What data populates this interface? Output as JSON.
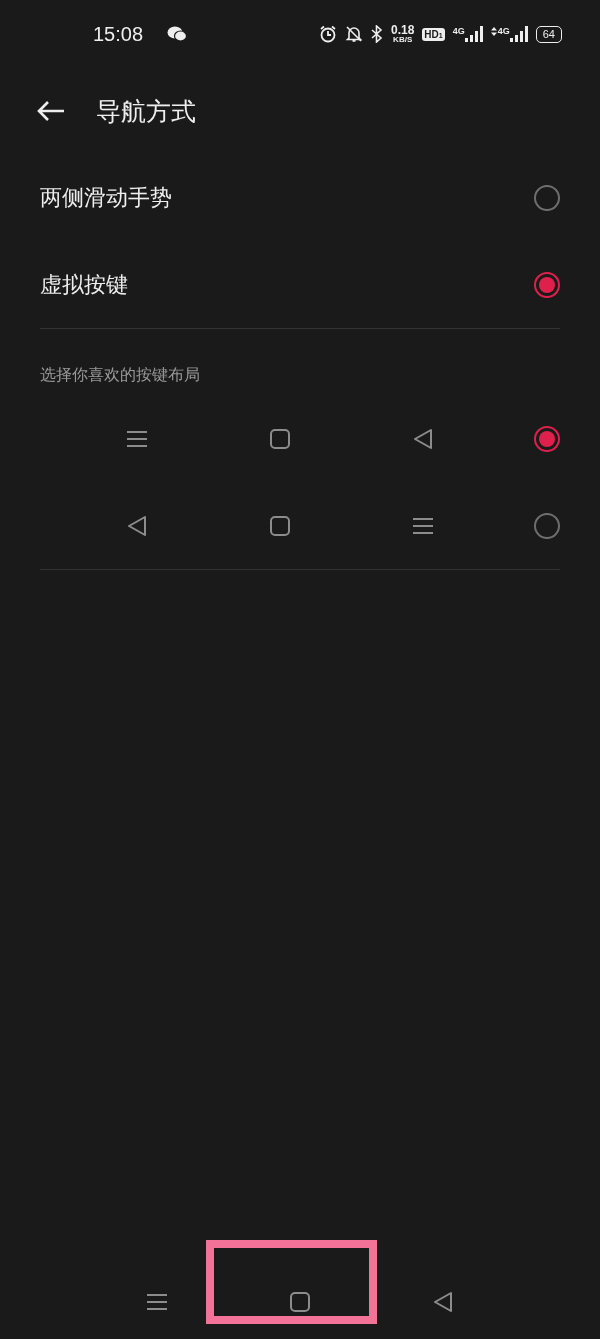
{
  "status_bar": {
    "time": "15:08",
    "speed_value": "0.18",
    "speed_unit": "KB/S",
    "hd_badge": "HD",
    "hd_index": "1",
    "signals": [
      {
        "label": "4G",
        "data_arrows": false
      },
      {
        "label": "4G",
        "data_arrows": true
      }
    ],
    "battery": "64"
  },
  "header": {
    "title": "导航方式"
  },
  "modes": [
    {
      "label": "两侧滑动手势",
      "selected": false
    },
    {
      "label": "虚拟按键",
      "selected": true
    }
  ],
  "layout_section": {
    "caption": "选择你喜欢的按键布局",
    "layouts": [
      {
        "keys": [
          {
            "kind": "menu"
          },
          {
            "kind": "home"
          },
          {
            "kind": "back"
          }
        ],
        "selected": true
      },
      {
        "keys": [
          {
            "kind": "back"
          },
          {
            "kind": "home"
          },
          {
            "kind": "menu"
          }
        ],
        "selected": false
      }
    ]
  },
  "nav_bar": {
    "keys": [
      {
        "kind": "menu"
      },
      {
        "kind": "home",
        "highlighted": true
      },
      {
        "kind": "back"
      }
    ]
  }
}
